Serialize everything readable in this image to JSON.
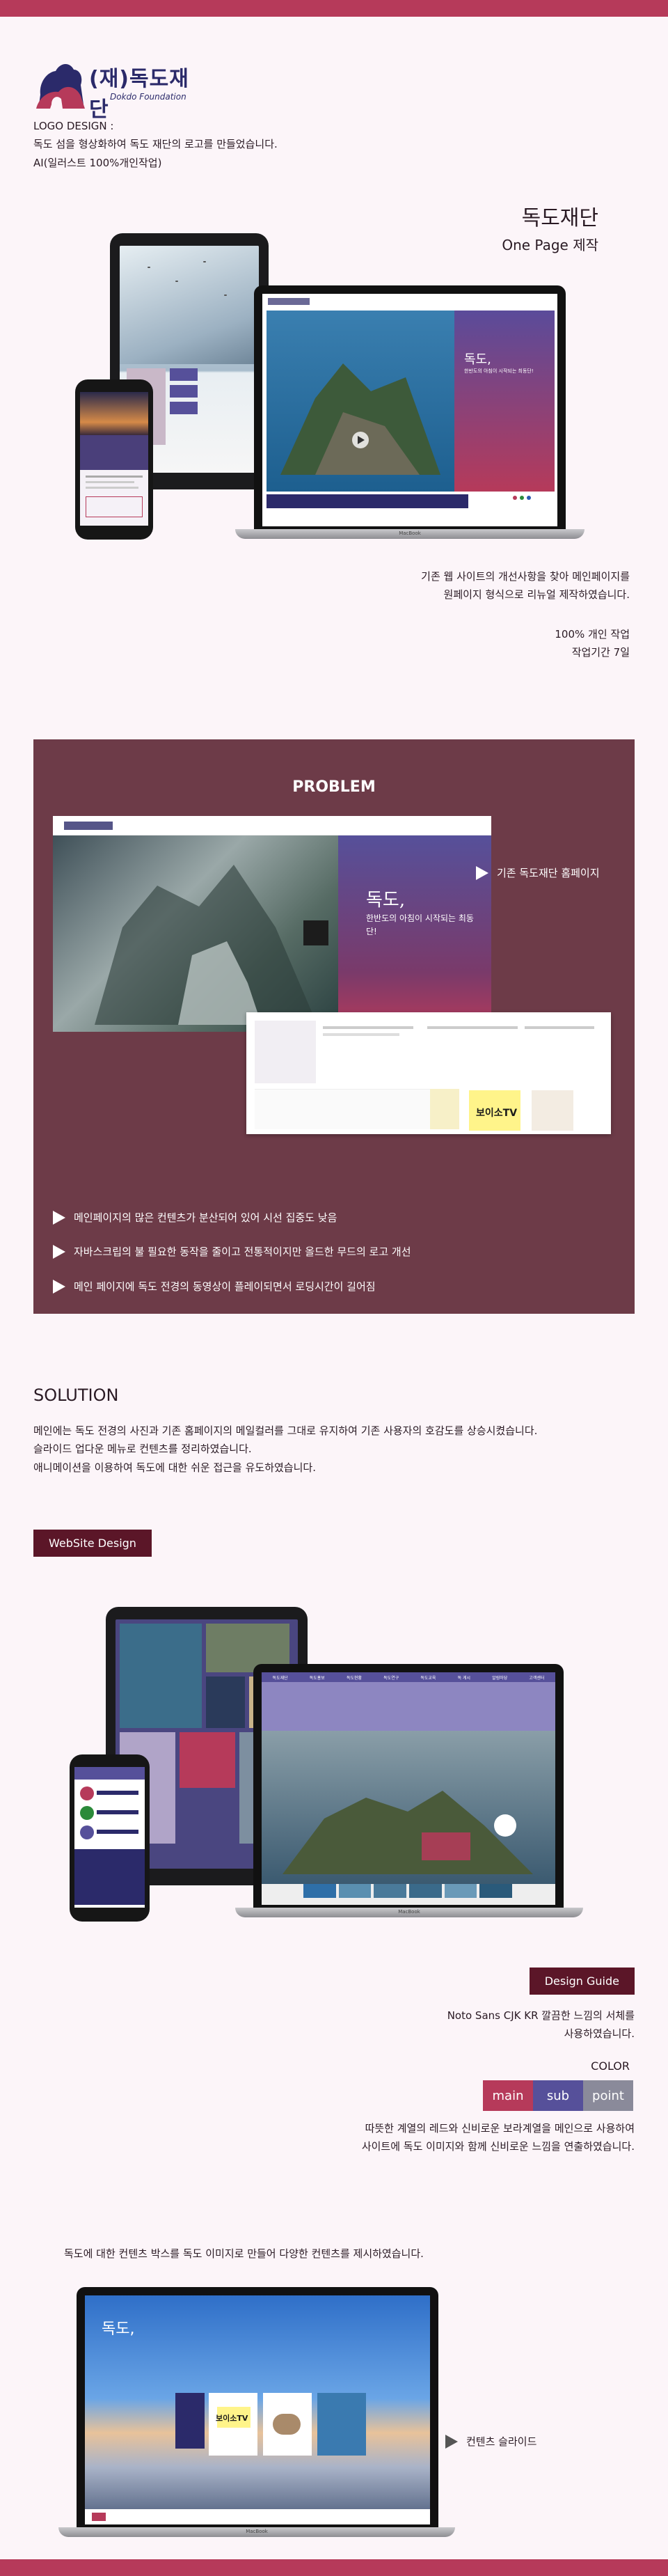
{
  "logo": {
    "korean": "(재)독도재단",
    "english": "Dokdo Foundation",
    "heading": "LOGO DESIGN :",
    "lines": [
      "독도 섬을 형상화하여 독도 재단의 로고를 만들었습니다.",
      "AI(일러스트 100%개인작업)"
    ]
  },
  "hero": {
    "title": "독도재단",
    "subtitle": "One Page 제작",
    "description": [
      "기존 웹 사이트의 개선사항을 찾아 메인페이지를",
      "원페이지 형식으로 리뉴얼 제작하였습니다."
    ],
    "meta": [
      "100% 개인 작업",
      "작업기간 7일"
    ],
    "mock_heading": "독도,",
    "mock_sub": "한반도의 아침이 시작되는 최동단!"
  },
  "problem": {
    "title": "PROBLEM",
    "existing_label": "기존 독도재단 홈페이지",
    "items": [
      "메인페이지의 많은 컨텐츠가 분산되어 있어 시선 집중도 낮음",
      "자바스크립의 불 필요한 동작을 줄이고 전통적이지만 올드한 무드의 로고 개선",
      "메인 페이지에 독도 전경의 동영상이 플레이되면서 로딩시간이 길어짐"
    ],
    "mock_title": "독도,",
    "mock_subtitle": "한반도의 아침이 시작되는 최동단!",
    "mock_tv": "보이소TV"
  },
  "solution": {
    "title": "SOLUTION",
    "lines": [
      "메인에는 독도 전경의 사진과 기존 홈페이지의 메일컬러를 그대로 유지하여 기존 사용자의 호감도를 상승시켰습니다.",
      "슬라이드 업다운 메뉴로 컨텐츠를 정리하였습니다.",
      "애니메이션을 이용하여 독도에 대한 쉬운 접근을 유도하였습니다."
    ]
  },
  "website": {
    "badge": "WebSite Design",
    "nav": [
      "독도재단",
      "독도홍보",
      "독도현황",
      "독도연구",
      "독도교육",
      "독 게시",
      "알림마당",
      "고객센터"
    ]
  },
  "guide": {
    "badge": "Design Guide",
    "font_text": [
      "Noto Sans CJK KR  깔끔한 느낌의 서체를",
      "사용하였습니다."
    ],
    "color_label": "COLOR",
    "colors": [
      {
        "label": "main",
        "hex": "#b63a5a"
      },
      {
        "label": "sub",
        "hex": "#56509a"
      },
      {
        "label": "point",
        "hex": "#8a8a9a"
      }
    ],
    "description": [
      "따뜻한 계열의 레드와 신비로운 보라계열을 메인으로 사용하여",
      "사이트에 독도 이미지와 함께 신비로운 느낌을 연출하였습니다."
    ]
  },
  "content": {
    "description": "독도에 대한 컨텐츠 박스를 독도 이미지로 만들어 다양한 컨텐츠를 제시하였습니다.",
    "slide_label": "컨텐츠 슬라이드",
    "mock_title": "독도,",
    "mock_tv": "보이소TV"
  },
  "laptop_brand": "MacBook"
}
